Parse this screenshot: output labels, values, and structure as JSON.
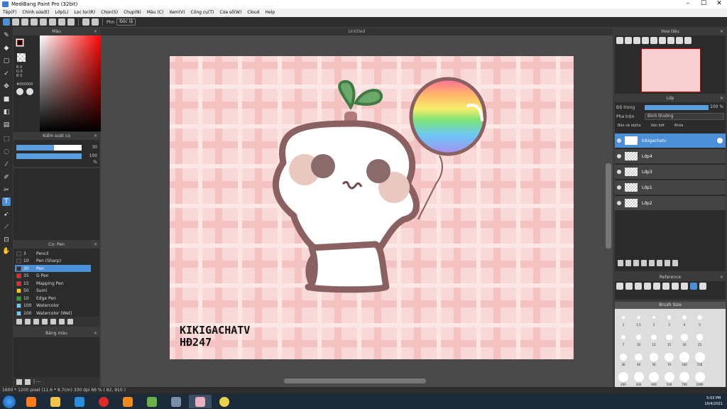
{
  "window": {
    "title": "MediBang Paint Pro (32bit)"
  },
  "menu": [
    "Tệp(F)",
    "Chỉnh sửa(E)",
    "Lớp(L)",
    "Lọc lọc(R)",
    "Chọn(S)",
    "Chụp(N)",
    "Màu (C)",
    "Xem(V)",
    "Công cụ(T)",
    "Cửa sổ(W)",
    "Cloud",
    "Help"
  ],
  "toolbar": {
    "brush_label": "Phn",
    "stabilizer_label": "Độc lậ"
  },
  "color_panel": {
    "title": "Màu",
    "rgb_text": "R 0\nG 0\nB 0\n\n#000000"
  },
  "brush_size_panel": {
    "title": "Kiểm soát cọ",
    "size_value": "30",
    "opacity_value": "100 %",
    "size_fraction": 0.58,
    "opacity_fraction": 1.0
  },
  "brush_panel": {
    "title": "Cọ: Pen",
    "brushes": [
      {
        "size": "3",
        "name": "Pencil",
        "color": "#333333",
        "selected": false
      },
      {
        "size": "10",
        "name": "Pen (Sharp)",
        "color": "#333333",
        "selected": false
      },
      {
        "size": "30",
        "name": "Pen",
        "color": "#333333",
        "selected": true
      },
      {
        "size": "35",
        "name": "G Pen",
        "color": "#ff2222",
        "selected": false
      },
      {
        "size": "15",
        "name": "Mapping Pen",
        "color": "#ff2222",
        "selected": false
      },
      {
        "size": "50",
        "name": "Sumi",
        "color": "#ffd000",
        "selected": false
      },
      {
        "size": "10",
        "name": "Edge Pen",
        "color": "#22aa22",
        "selected": false
      },
      {
        "size": "100",
        "name": "Watercolor",
        "color": "#66ccff",
        "selected": false
      },
      {
        "size": "100",
        "name": "Watercolor (Wet)",
        "color": "#66ccff",
        "selected": false
      }
    ]
  },
  "blend_panel": {
    "title": "Bảng màu",
    "footer_text": "| ---"
  },
  "canvas": {
    "doc_title": "Untitled",
    "art_text_line1": "KIKIGACHATV",
    "art_text_line2": "HĐ247"
  },
  "navigator": {
    "title": "Hoa tiêu"
  },
  "layers_panel": {
    "title": "Lớp",
    "opacity_label": "Độ trong",
    "opacity_value": "100 %",
    "blend_label": "Pha trộn",
    "blend_value": "Bình thường",
    "checks": [
      "Bảo vệ alpha",
      "Xén bớt",
      "Khóa"
    ],
    "layers": [
      {
        "name": "kikigachatv",
        "selected": true
      },
      {
        "name": "Lớp4",
        "selected": false
      },
      {
        "name": "Lớp3",
        "selected": false
      },
      {
        "name": "Lớp1",
        "selected": false
      },
      {
        "name": "Lớp2",
        "selected": false
      }
    ]
  },
  "reference_panel": {
    "title": "Reference"
  },
  "brush_size_grid": {
    "title": "Brush Size",
    "rows": [
      [
        "1",
        "1.5",
        "2",
        "3",
        "4",
        "5"
      ],
      [
        "7",
        "10",
        "12",
        "15",
        "20",
        "25"
      ],
      [
        "30",
        "40",
        "50",
        "70",
        "100",
        "150"
      ],
      [
        "200",
        "300",
        "400",
        "500",
        "700",
        "1000"
      ]
    ]
  },
  "status": {
    "text": "1600 * 1200 pixel  (11.6 * 8.7cm)  330 dpi  66 %  ( 82, 910 )"
  },
  "taskbar": {
    "time": "5:03 PM",
    "date": "10/4/2021"
  }
}
